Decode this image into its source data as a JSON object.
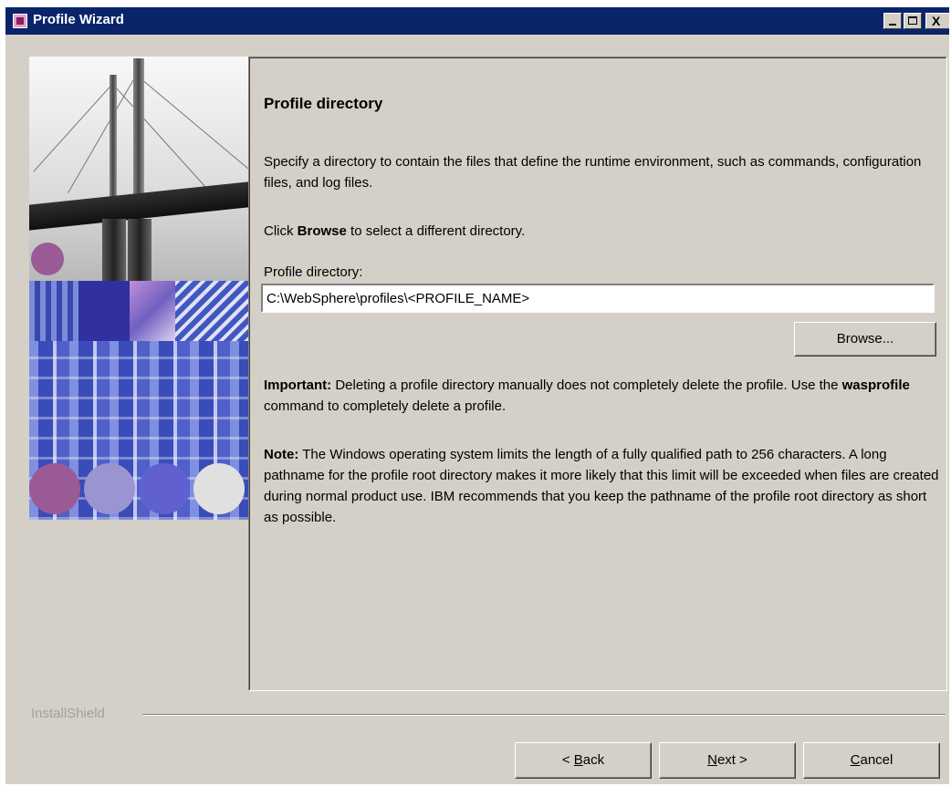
{
  "window": {
    "title": "Profile Wizard",
    "controls": {
      "minimize": "_",
      "maximize": "□",
      "close": "X"
    }
  },
  "page": {
    "heading": "Profile directory",
    "description": "Specify a directory to contain the files that define the runtime environment, such as commands, configuration files, and log files.",
    "click_prefix": "Click ",
    "click_bold": "Browse",
    "click_suffix": " to select a different directory.",
    "field_label": "Profile directory:",
    "field_value": "C:\\WebSphere\\profiles\\<PROFILE_NAME>",
    "browse_button": "Browse...",
    "important_label": "Important:",
    "important_text_1": " Deleting a profile directory manually does not completely delete the profile. Use the ",
    "important_bold": "wasprofile",
    "important_text_2": " command to completely delete a profile.",
    "note_label": "Note:",
    "note_text": " The Windows operating system limits the length of a fully qualified path to 256 characters. A long pathname for the profile root directory makes it more likely that this limit will be exceeded when files are created during normal product use. IBM recommends that you keep the pathname of the profile root directory as short as possible."
  },
  "footer": {
    "brand": "InstallShield",
    "back_prefix": "< ",
    "back_key": "B",
    "back_rest": "ack",
    "next_key": "N",
    "next_rest": "ext >",
    "cancel_key": "C",
    "cancel_rest": "ancel"
  },
  "colors": {
    "titlebar": "#0a246a",
    "window_bg": "#d4d0c8",
    "circle_1": "#9a5a96",
    "circle_2": "#9a94d0",
    "circle_3": "#6060d0",
    "circle_4": "#e0e0e0"
  },
  "icons": {
    "app": "profile-wizard-app-icon"
  }
}
